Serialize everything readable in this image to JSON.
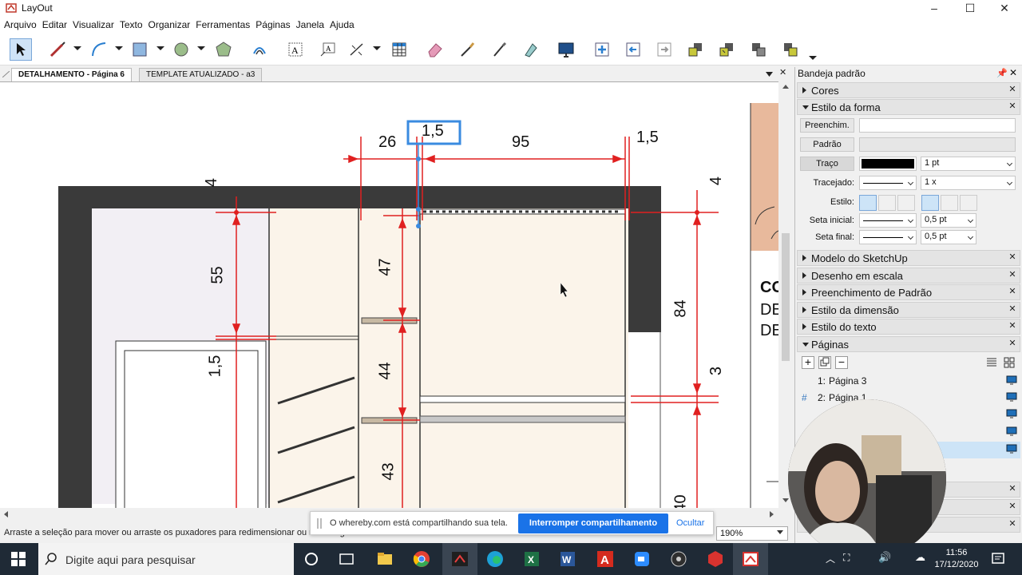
{
  "window": {
    "title": "LayOut",
    "minimize": "–",
    "maximize": "☐",
    "close": "✕"
  },
  "menu": [
    "Arquivo",
    "Editar",
    "Visualizar",
    "Texto",
    "Organizar",
    "Ferramentas",
    "Páginas",
    "Janela",
    "Ajuda"
  ],
  "toolbar": {
    "tools": [
      "select-icon",
      "line-icon",
      "arc-icon",
      "rectangle-icon",
      "circle-icon",
      "polygon-icon",
      "offset-icon",
      "text-icon",
      "label-icon",
      "dimension-icon",
      "table-icon",
      "eraser-icon",
      "style-icon",
      "split-icon",
      "join-icon",
      "presentation-icon",
      "add-page-icon",
      "previous-page-icon",
      "next-page-icon",
      "arrange-front-icon",
      "arrange-forward-icon",
      "arrange-backward-icon",
      "arrange-back-icon"
    ]
  },
  "tabs": [
    {
      "label": "DETALHAMENTO - Página 6",
      "active": true
    },
    {
      "label": "TEMPLATE ATUALIZADO - a3",
      "active": false
    }
  ],
  "drawing": {
    "dims": [
      "1,5",
      "26",
      "95",
      "1,5",
      "4",
      "4",
      "55",
      "47",
      "84",
      "1,5",
      "44",
      "3",
      "43",
      "40"
    ],
    "side_text": [
      "CO",
      "DE",
      "DE"
    ]
  },
  "status": {
    "hint": "Arraste a seleção para mover ou arraste os puxadores para redimensionar ou rotar. Digi",
    "zoom": "190%"
  },
  "share_banner": {
    "message": "O whereby.com está compartilhando sua tela.",
    "stop": "Interromper compartilhamento",
    "hide": "Ocultar"
  },
  "panel": {
    "title": "Bandeja padrão",
    "sections": {
      "cores": "Cores",
      "estilo_forma": "Estilo da forma",
      "modelo": "Modelo do SketchUp",
      "escala": "Desenho em escala",
      "padrao": "Preenchimento de Padrão",
      "dimensao": "Estilo da dimensão",
      "texto": "Estilo do texto",
      "paginas": "Páginas"
    },
    "shape_style": {
      "fill_btn": "Preenchim.",
      "pattern_btn": "Padrão",
      "stroke_btn": "Traço",
      "stroke_width": "1 pt",
      "dash_label": "Tracejado:",
      "dash_scale": "1 x",
      "style_label": "Estilo:",
      "start_label": "Seta inicial:",
      "start_size": "0,5 pt",
      "end_label": "Seta final:",
      "end_size": "0,5 pt",
      "stroke_color": "#000000"
    },
    "pages": [
      {
        "num": "1:",
        "name": "Página 3"
      },
      {
        "num": "2:",
        "name": "Página 1"
      }
    ]
  },
  "taskbar": {
    "search_placeholder": "Digite aqui para pesquisar",
    "time": "11:56",
    "date": "17/12/2020"
  }
}
